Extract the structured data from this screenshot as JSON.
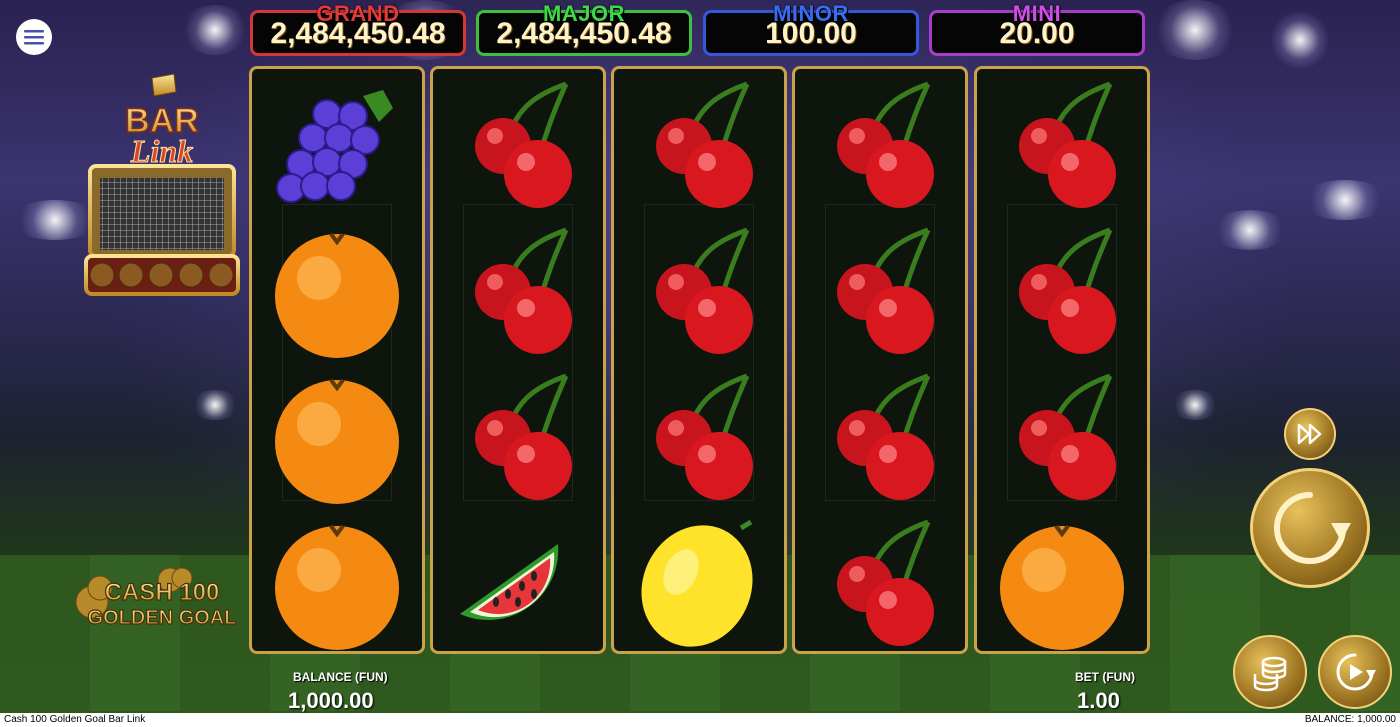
{
  "window": {
    "title": "Cash 100 Golden Goal Bar Link"
  },
  "jackpots": [
    {
      "name": "GRAND",
      "value": "2,484,450.48"
    },
    {
      "name": "MAJOR",
      "value": "2,484,450.48"
    },
    {
      "name": "MINOR",
      "value": "100.00"
    },
    {
      "name": "MINI",
      "value": "20.00"
    }
  ],
  "logos": {
    "bar_link_top": "BAR",
    "bar_link_bottom": "Link",
    "cash_top": "CASH 100",
    "cash_bottom": "GOLDEN GOAL"
  },
  "reels": [
    [
      "grapes",
      "orange",
      "orange",
      "orange"
    ],
    [
      "cherry",
      "cherry",
      "cherry",
      "watermelon"
    ],
    [
      "cherry",
      "cherry",
      "cherry",
      "lemon"
    ],
    [
      "cherry",
      "cherry",
      "cherry",
      "cherry"
    ],
    [
      "cherry",
      "cherry",
      "cherry",
      "orange"
    ]
  ],
  "balance": {
    "label": "BALANCE (FUN)",
    "value": "1,000.00"
  },
  "bet": {
    "label": "BET (FUN)",
    "value": "1.00"
  },
  "status": {
    "left": "Cash 100 Golden Goal Bar Link",
    "right": "BALANCE: 1,000.00"
  },
  "icons": {
    "menu": "hamburger-icon",
    "turbo": "fast-forward-icon",
    "spin": "spin-arrow-icon",
    "bet": "coin-stack-icon",
    "autoplay": "autoplay-icon"
  },
  "colors": {
    "grand": "#d33838",
    "major": "#3fbf3f",
    "minor": "#3458d6",
    "mini": "#a93cc9",
    "gold": "#c9a24a"
  }
}
